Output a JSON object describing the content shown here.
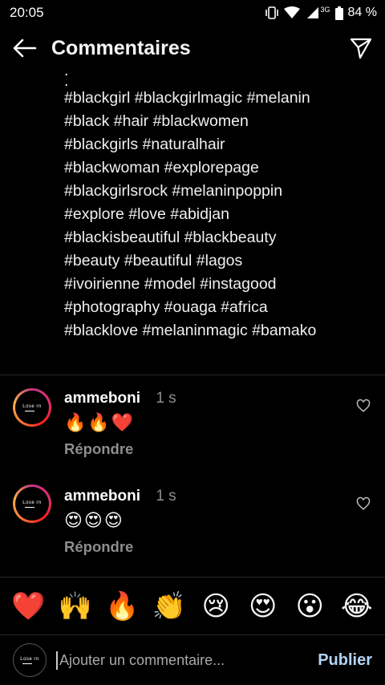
{
  "status_bar": {
    "time": "20:05",
    "network": "3G",
    "battery": "84 %"
  },
  "header": {
    "title": "Commentaires",
    "back_icon": "arrow-left-icon",
    "send_icon": "paper-plane-icon"
  },
  "caption": {
    "dots": [
      ".",
      "."
    ],
    "lines": [
      "#blackgirl #blackgirlmagic #melanin",
      "#black #hair #blackwomen",
      "#blackgirls #naturalhair",
      "#blackwoman #explorepage",
      "#blackgirlsrock #melaninpoppin",
      "#explore #love #abidjan",
      "#blackisbeautiful #blackbeauty",
      "#beauty #beautiful #lagos",
      "#ivoirienne #model #instagood",
      "#photography #ouaga #africa",
      "#blacklove #melaninmagic #bamako"
    ]
  },
  "comments": [
    {
      "username": "ammeboni",
      "time": "1 s",
      "text": "🔥🔥❤️",
      "reply": "Répondre"
    },
    {
      "username": "ammeboni",
      "time": "1 s",
      "text": "😍😍😍",
      "reply": "Répondre"
    }
  ],
  "avatar_logo_text": "Lose rn",
  "emoji_bar": [
    "❤️",
    "🙌",
    "🔥",
    "👏",
    "😢",
    "😍",
    "😮",
    "😂"
  ],
  "composer": {
    "placeholder": "Ajouter un commentaire...",
    "publish_label": "Publier"
  },
  "colors": {
    "background": "#000000",
    "muted": "#8e8e8e",
    "publish": "#b3d4f5"
  }
}
